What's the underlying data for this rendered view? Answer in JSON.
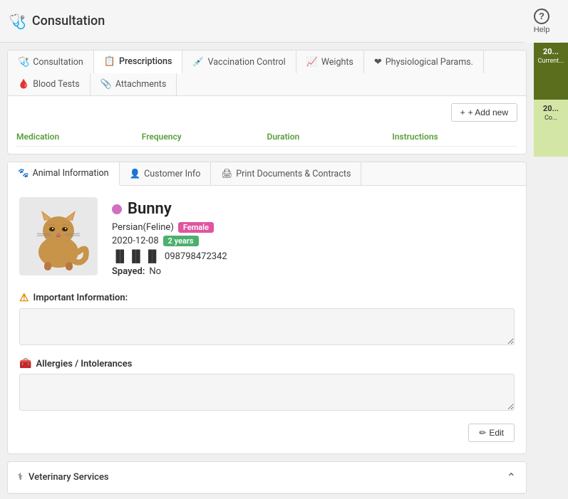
{
  "header": {
    "title": "Consultation",
    "stethoscope_icon": "⚕",
    "help_label": "Help",
    "help_icon": "?"
  },
  "tabs": {
    "items": [
      {
        "id": "consultation",
        "label": "Consultation",
        "icon": "⚕",
        "active": false
      },
      {
        "id": "prescriptions",
        "label": "Prescriptions",
        "icon": "📋",
        "active": true
      },
      {
        "id": "vaccination",
        "label": "Vaccination Control",
        "icon": "💉",
        "active": false
      },
      {
        "id": "weights",
        "label": "Weights",
        "icon": "📈",
        "active": false
      },
      {
        "id": "physiological",
        "label": "Physiological Params.",
        "icon": "❤",
        "active": false
      },
      {
        "id": "blood",
        "label": "Blood Tests",
        "icon": "🩸",
        "active": false
      },
      {
        "id": "attachments",
        "label": "Attachments",
        "icon": "📎",
        "active": false
      }
    ],
    "add_new_label": "+ Add new",
    "columns": [
      {
        "label": "Medication",
        "key": "medication"
      },
      {
        "label": "Frequency",
        "key": "frequency"
      },
      {
        "label": "Duration",
        "key": "duration"
      },
      {
        "label": "Instructions",
        "key": "instructions"
      }
    ]
  },
  "animal_tabs": {
    "items": [
      {
        "id": "animal_info",
        "label": "Animal Information",
        "icon": "🐾",
        "active": true
      },
      {
        "id": "customer_info",
        "label": "Customer Info",
        "icon": "👤",
        "active": false
      },
      {
        "id": "print_docs",
        "label": "Print Documents & Contracts",
        "icon": "🖨",
        "active": false
      }
    ]
  },
  "animal": {
    "name": "Bunny",
    "status_dot_color": "#d070c0",
    "species": "Persian(Feline)",
    "sex_badge": "Female",
    "sex_badge_color": "#e055a0",
    "birth_date": "2020-12-08",
    "age_badge": "2 years",
    "age_badge_color": "#4db06e",
    "barcode": "098798472342",
    "spayed_label": "Spayed:",
    "spayed_value": "No",
    "important_info_title": "Important Information:",
    "important_info_value": "",
    "important_info_placeholder": "",
    "allergies_title": "Allergies / Intolerances",
    "allergies_value": "",
    "edit_label": "✏ Edit"
  },
  "vet_services": {
    "title": "Veterinary Services",
    "icon": "⚕",
    "chevron": "⌃"
  },
  "sidebar": {
    "cards": [
      {
        "year": "20...",
        "label": "Current...",
        "style": "dark"
      },
      {
        "year": "20...",
        "label": "Co...",
        "style": "light"
      }
    ]
  }
}
